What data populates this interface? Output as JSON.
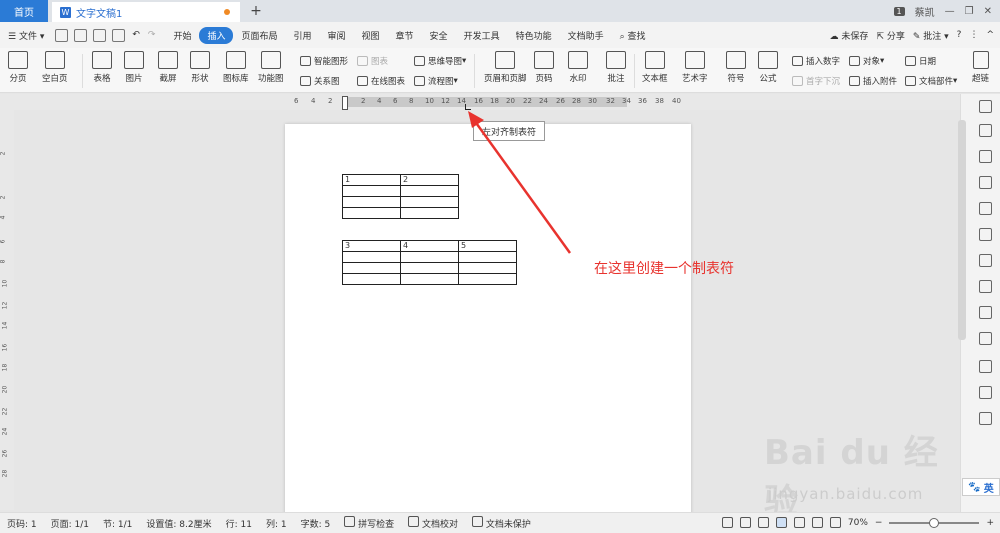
{
  "tabs": {
    "home": "首页",
    "document": "文字文稿1",
    "new_tab": "+",
    "window_num": "1",
    "user": "蔡凯"
  },
  "menu": {
    "file": "文件",
    "items": [
      "开始",
      "插入",
      "页面布局",
      "引用",
      "审阅",
      "视图",
      "章节",
      "安全",
      "开发工具",
      "特色功能",
      "文档助手"
    ],
    "active": "插入",
    "search": "查找",
    "unsaved": "未保存",
    "share": "分享",
    "comment": "批注",
    "help": "?"
  },
  "ribbon": {
    "page_break": "分页",
    "blank_page": "空白页",
    "table": "表格",
    "picture": "图片",
    "screenshot": "截屏",
    "shape": "形状",
    "icon_lib": "图标库",
    "func_chart": "功能图",
    "smart_shape": "智能图形",
    "chart": "图表",
    "relation": "关系图",
    "online_chart": "在线图表",
    "mindmap": "思维导图",
    "flowchart": "流程图",
    "header_footer": "页眉和页脚",
    "page_num": "页码",
    "watermark": "水印",
    "annotation": "批注",
    "textbox": "文本框",
    "wordart": "艺术字",
    "symbol": "符号",
    "formula": "公式",
    "insert_number": "插入数字",
    "object": "对象",
    "date": "日期",
    "drop_cap": "首字下沉",
    "attachment": "插入附件",
    "doc_parts": "文档部件",
    "hyperlink": "超链"
  },
  "ruler": {
    "ticks": [
      "6",
      "4",
      "2",
      "2",
      "4",
      "6",
      "8",
      "10",
      "12",
      "14",
      "16",
      "18",
      "20",
      "22",
      "24",
      "26",
      "28",
      "30",
      "32",
      "34",
      "36",
      "38",
      "40"
    ]
  },
  "vruler": {
    "ticks": [
      "2",
      "2",
      "4",
      "6",
      "8",
      "10",
      "12",
      "14",
      "16",
      "18",
      "20",
      "22",
      "24",
      "26",
      "28"
    ]
  },
  "tooltip": "左对齐制表符",
  "annotation": "在这里创建一个制表符",
  "table1": {
    "rows": [
      [
        "1",
        "2"
      ],
      [
        "",
        ""
      ],
      [
        "",
        ""
      ],
      [
        "",
        ""
      ]
    ]
  },
  "table2": {
    "rows": [
      [
        "3",
        "4",
        "5"
      ],
      [
        "",
        "",
        ""
      ],
      [
        "",
        "",
        ""
      ],
      [
        "",
        "",
        ""
      ]
    ]
  },
  "status": {
    "page_num": "页码: 1",
    "pages": "页面: 1/1",
    "section": "节: 1/1",
    "setting": "设置值: 8.2厘米",
    "row": "行: 11",
    "col": "列: 1",
    "words": "字数: 5",
    "spell": "拼写检查",
    "proof": "文档校对",
    "protect": "文档未保护",
    "zoom": "70%",
    "zoom_level": 0.5,
    "minus": "−",
    "plus": "+"
  },
  "watermark": {
    "brand": "Bai du 经验",
    "url": "jingyan.baidu.com"
  },
  "input_badge": "英"
}
